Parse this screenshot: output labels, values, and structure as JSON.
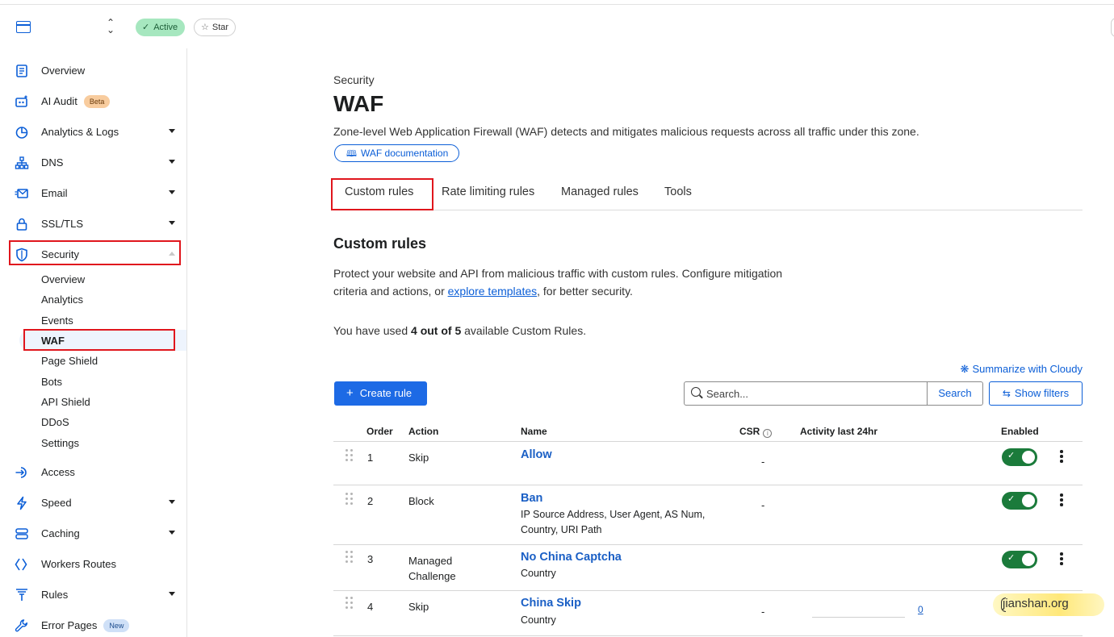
{
  "topbar": {
    "status": "Active",
    "star": "Star"
  },
  "sidebar": {
    "items": [
      {
        "label": "Overview",
        "icon": "document-icon"
      },
      {
        "label": "AI Audit",
        "icon": "ai-audit-icon",
        "tag": "Beta"
      },
      {
        "label": "Analytics & Logs",
        "icon": "pie-chart-icon",
        "expandable": true
      },
      {
        "label": "DNS",
        "icon": "network-icon",
        "expandable": true
      },
      {
        "label": "Email",
        "icon": "email-icon",
        "expandable": true
      },
      {
        "label": "SSL/TLS",
        "icon": "lock-icon",
        "expandable": true
      },
      {
        "label": "Security",
        "icon": "shield-icon",
        "expanded": true
      },
      {
        "label": "Access",
        "icon": "access-icon"
      },
      {
        "label": "Speed",
        "icon": "lightning-icon",
        "expandable": true
      },
      {
        "label": "Caching",
        "icon": "caching-icon",
        "expandable": true
      },
      {
        "label": "Workers Routes",
        "icon": "workers-icon"
      },
      {
        "label": "Rules",
        "icon": "rules-icon",
        "expandable": true
      },
      {
        "label": "Error Pages",
        "icon": "wrench-icon",
        "tag": "New"
      }
    ],
    "security_sub": [
      "Overview",
      "Analytics",
      "Events",
      "WAF",
      "Page Shield",
      "Bots",
      "API Shield",
      "DDoS",
      "Settings"
    ],
    "active_sub": "WAF"
  },
  "page": {
    "crumb": "Security",
    "title": "WAF",
    "description": "Zone-level Web Application Firewall (WAF) detects and mitigates malicious requests across all traffic under this zone.",
    "doc_link": "WAF documentation"
  },
  "tabs": [
    "Custom rules",
    "Rate limiting rules",
    "Managed rules",
    "Tools"
  ],
  "active_tab": "Custom rules",
  "section": {
    "title": "Custom rules",
    "desc_part1": "Protect your website and API from malicious traffic with custom rules. Configure mitigation criteria and actions, or ",
    "desc_link": "explore templates",
    "desc_part2": ", for better security.",
    "usage_prefix": "You have used ",
    "usage_count": "4 out of 5",
    "usage_suffix": " available Custom Rules.",
    "summarize": "Summarize with Cloudy"
  },
  "toolbar": {
    "create": "Create rule",
    "search_placeholder": "Search...",
    "search_button": "Search",
    "filters": "Show filters"
  },
  "table": {
    "headers": {
      "order": "Order",
      "action": "Action",
      "name": "Name",
      "csr": "CSR",
      "activity": "Activity last 24hr",
      "enabled": "Enabled"
    },
    "rows": [
      {
        "order": "1",
        "action": "Skip",
        "name": "Allow",
        "sub": "",
        "csr": "-",
        "enabled": true
      },
      {
        "order": "2",
        "action": "Block",
        "name": "Ban",
        "sub": "IP Source Address, User Agent, AS Num, Country, URI Path",
        "csr": "-",
        "enabled": true
      },
      {
        "order": "3",
        "action": "Managed Challenge",
        "name": "No China Captcha",
        "sub": "Country",
        "csr": "",
        "enabled": true
      },
      {
        "order": "4",
        "action": "Skip",
        "name": "China Skip",
        "sub": "Country",
        "csr": "-",
        "activity": "0",
        "enabled": null
      }
    ]
  },
  "watermark": "jianshan.org",
  "colors": {
    "accent": "#0b5ed7",
    "primary_button": "#1d6ae5",
    "toggle_on": "#1b7b3b",
    "highlight": "#e0161d",
    "active_badge": "#a6e7bf"
  }
}
